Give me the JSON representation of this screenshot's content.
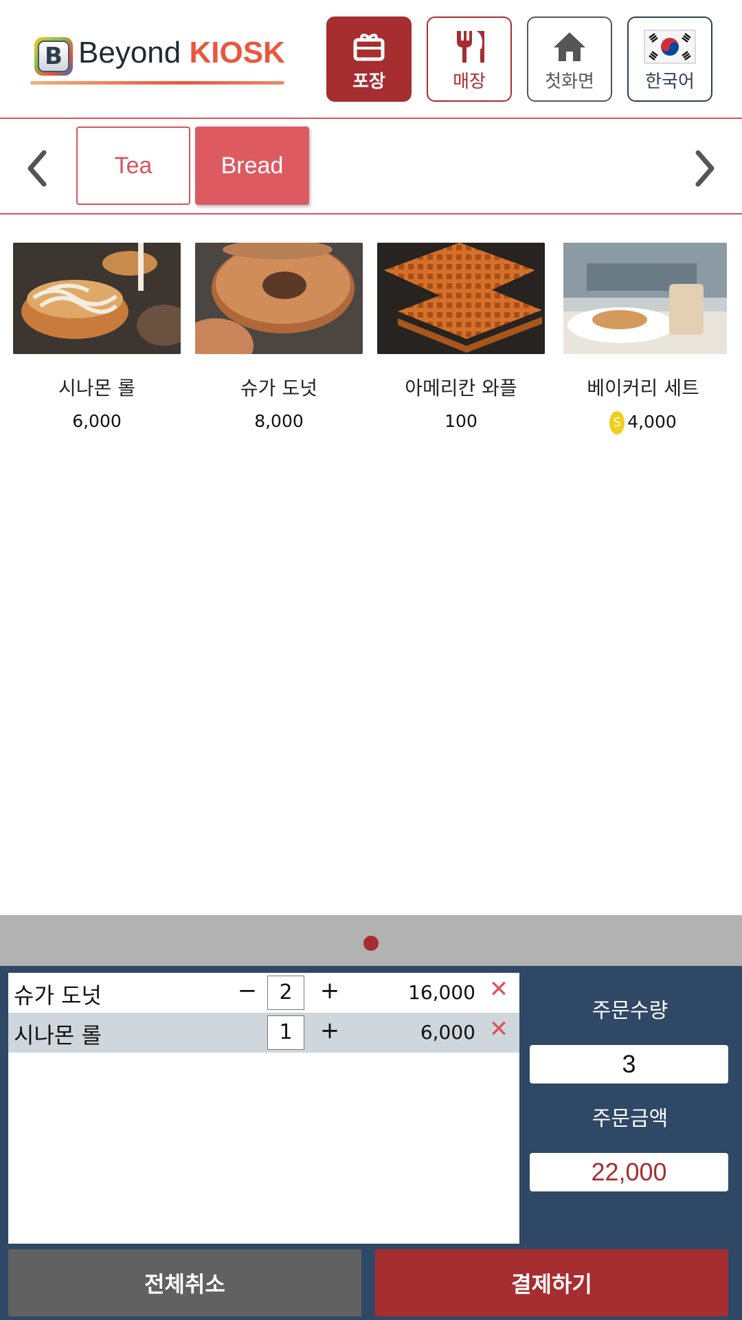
{
  "brand": {
    "logo_letter": "B",
    "name_part1": "Beyond ",
    "name_part2": "KIOSK"
  },
  "header_buttons": [
    {
      "label": "포장",
      "icon": "takeout-bag-icon",
      "active": true
    },
    {
      "label": "매장",
      "icon": "fork-knife-icon",
      "active": false
    },
    {
      "label": "첫화면",
      "icon": "home-icon",
      "active": false
    },
    {
      "label": "한국어",
      "icon": "korea-flag-icon",
      "active": false
    }
  ],
  "categories": [
    {
      "label": "Tea",
      "selected": false
    },
    {
      "label": "Bread",
      "selected": true
    }
  ],
  "products": [
    {
      "name": "시나몬 롤",
      "price": "6,000",
      "has_coin": false
    },
    {
      "name": "슈가 도넛",
      "price": "8,000",
      "has_coin": false
    },
    {
      "name": "아메리칸 와플",
      "price": "100",
      "has_coin": false
    },
    {
      "name": "베이커리 세트",
      "price": "4,000",
      "has_coin": true,
      "coin_letter": "S"
    }
  ],
  "pager": {
    "pages": 1,
    "current": 1
  },
  "order": {
    "items": [
      {
        "name": "슈가 도넛",
        "qty": "2",
        "amount": "16,000",
        "minus": "−",
        "plus": "+",
        "remove": "✕"
      },
      {
        "name": "시나몬 롤",
        "qty": "1",
        "amount": "6,000",
        "plus": "+",
        "remove": "✕"
      }
    ],
    "qty_label": "주문수량",
    "qty_total": "3",
    "amount_label": "주문금액",
    "amount_total": "22,000"
  },
  "actions": {
    "cancel_all": "전체취소",
    "pay": "결제하기"
  },
  "colors": {
    "primary": "#a62d30",
    "accent": "#dd5a61",
    "panel": "#2e4865",
    "pager": "#b1b2b1",
    "cancel": "#616161"
  }
}
